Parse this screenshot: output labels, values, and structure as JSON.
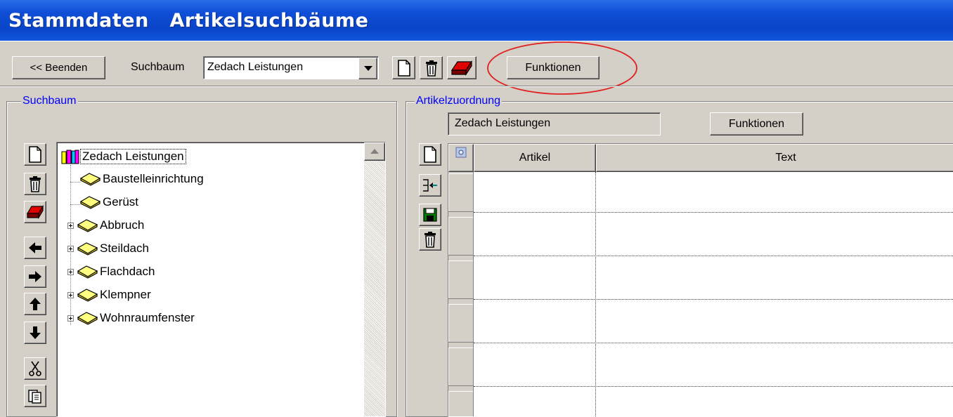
{
  "window": {
    "title": "Stammdaten   Artikelsuchbäume"
  },
  "toolbar": {
    "exit_label": "<< Beenden",
    "search_tree_label": "Suchbaum",
    "search_tree_value": "Zedach Leistungen",
    "functions_label": "Funktionen"
  },
  "left_panel": {
    "group_label": "Suchbaum",
    "tree": {
      "root": "Zedach Leistungen",
      "children": [
        {
          "label": "Baustelleinrichtung",
          "expandable": false
        },
        {
          "label": "Gerüst",
          "expandable": false
        },
        {
          "label": "Abbruch",
          "expandable": true
        },
        {
          "label": "Steildach",
          "expandable": true
        },
        {
          "label": "Flachdach",
          "expandable": true
        },
        {
          "label": "Klempner",
          "expandable": true
        },
        {
          "label": "Wohnraumfenster",
          "expandable": true
        }
      ]
    }
  },
  "right_panel": {
    "group_label": "Artikelzuordnung",
    "selected_node": "Zedach Leistungen",
    "functions_label": "Funktionen",
    "table": {
      "columns": [
        "Artikel",
        "Text"
      ],
      "rows": []
    }
  },
  "colors": {
    "title_bar": "#0845c8",
    "group_label": "#0000ff",
    "annotation_circle": "#e02020",
    "face": "#d4d0c8"
  }
}
